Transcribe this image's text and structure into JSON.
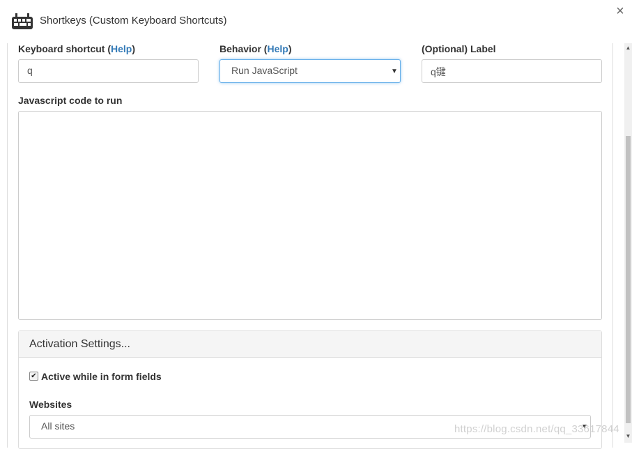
{
  "window": {
    "title": "Shortkeys (Custom Keyboard Shortcuts)",
    "close_glyph": "×",
    "icon": "keyboard-icon"
  },
  "fields": {
    "shortcut": {
      "label_prefix": "Keyboard shortcut (",
      "help": "Help",
      "label_suffix": ")",
      "value": "q"
    },
    "behavior": {
      "label_prefix": "Behavior (",
      "help": "Help",
      "label_suffix": ")",
      "value": "Run JavaScript",
      "caret": "▼"
    },
    "label": {
      "label": "(Optional) Label",
      "value": "q键"
    },
    "code": {
      "label": "Javascript code to run",
      "value": ""
    }
  },
  "activation": {
    "title": "Activation Settings...",
    "form_fields": {
      "checked": true,
      "check_glyph": "✔",
      "label": "Active while in form fields"
    },
    "websites": {
      "label": "Websites",
      "value": "All sites",
      "caret": "▼"
    }
  },
  "scrollbar": {
    "up": "▲",
    "down": "▼"
  },
  "watermark": "https://blog.csdn.net/qq_33617844",
  "colors": {
    "link": "#337ab7",
    "focus": "#66afe9",
    "panel_header": "#f5f5f5"
  }
}
